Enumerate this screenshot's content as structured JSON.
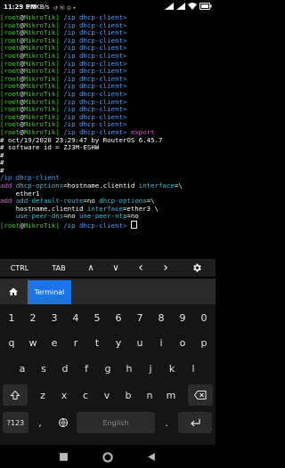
{
  "status_bar": {
    "time": "11:29 PM",
    "data_rate": "0.1KB/s",
    "system_icons": "↺ Ⓝ ⊙ •"
  },
  "terminal": {
    "lines": [
      [
        {
          "t": "[root",
          "c": "g"
        },
        {
          "t": "@",
          "c": "w"
        },
        {
          "t": "MikroTik",
          "c": "g"
        },
        {
          "t": "] ",
          "c": "g"
        },
        {
          "t": "/ip dhcp-client>",
          "c": "b"
        }
      ],
      [
        {
          "t": "[root",
          "c": "g"
        },
        {
          "t": "@",
          "c": "w"
        },
        {
          "t": "MikroTik",
          "c": "g"
        },
        {
          "t": "] ",
          "c": "g"
        },
        {
          "t": "/ip dhcp-client>",
          "c": "b"
        }
      ],
      [
        {
          "t": "[root",
          "c": "g"
        },
        {
          "t": "@",
          "c": "w"
        },
        {
          "t": "MikroTik",
          "c": "g"
        },
        {
          "t": "] ",
          "c": "g"
        },
        {
          "t": "/ip dhcp-client>",
          "c": "b"
        }
      ],
      [
        {
          "t": "[root",
          "c": "g"
        },
        {
          "t": "@",
          "c": "w"
        },
        {
          "t": "MikroTik",
          "c": "g"
        },
        {
          "t": "] ",
          "c": "g"
        },
        {
          "t": "/ip dhcp-client>",
          "c": "b"
        }
      ],
      [
        {
          "t": "[root",
          "c": "g"
        },
        {
          "t": "@",
          "c": "w"
        },
        {
          "t": "MikroTik",
          "c": "g"
        },
        {
          "t": "] ",
          "c": "g"
        },
        {
          "t": "/ip dhcp-client>",
          "c": "b"
        }
      ],
      [
        {
          "t": "[root",
          "c": "g"
        },
        {
          "t": "@",
          "c": "w"
        },
        {
          "t": "MikroTik",
          "c": "g"
        },
        {
          "t": "] ",
          "c": "g"
        },
        {
          "t": "/ip dhcp-client>",
          "c": "b"
        }
      ],
      [
        {
          "t": "[root",
          "c": "g"
        },
        {
          "t": "@",
          "c": "w"
        },
        {
          "t": "MikroTik",
          "c": "g"
        },
        {
          "t": "] ",
          "c": "g"
        },
        {
          "t": "/ip dhcp-client>",
          "c": "b"
        }
      ],
      [
        {
          "t": "[root",
          "c": "g"
        },
        {
          "t": "@",
          "c": "w"
        },
        {
          "t": "MikroTik",
          "c": "g"
        },
        {
          "t": "] ",
          "c": "g"
        },
        {
          "t": "/ip dhcp-client>",
          "c": "b"
        }
      ],
      [
        {
          "t": "[root",
          "c": "g"
        },
        {
          "t": "@",
          "c": "w"
        },
        {
          "t": "MikroTik",
          "c": "g"
        },
        {
          "t": "] ",
          "c": "g"
        },
        {
          "t": "/ip dhcp-client>",
          "c": "b"
        }
      ],
      [
        {
          "t": "[root",
          "c": "g"
        },
        {
          "t": "@",
          "c": "w"
        },
        {
          "t": "MikroTik",
          "c": "g"
        },
        {
          "t": "] ",
          "c": "g"
        },
        {
          "t": "/ip dhcp-client>",
          "c": "b"
        }
      ],
      [
        {
          "t": "[root",
          "c": "g"
        },
        {
          "t": "@",
          "c": "w"
        },
        {
          "t": "MikroTik",
          "c": "g"
        },
        {
          "t": "] ",
          "c": "g"
        },
        {
          "t": "/ip dhcp-client>",
          "c": "b"
        }
      ],
      [
        {
          "t": "[root",
          "c": "g"
        },
        {
          "t": "@",
          "c": "w"
        },
        {
          "t": "MikroTik",
          "c": "g"
        },
        {
          "t": "] ",
          "c": "g"
        },
        {
          "t": "/ip dhcp-client>",
          "c": "b"
        }
      ],
      [
        {
          "t": "[root",
          "c": "g"
        },
        {
          "t": "@",
          "c": "w"
        },
        {
          "t": "MikroTik",
          "c": "g"
        },
        {
          "t": "] ",
          "c": "g"
        },
        {
          "t": "/ip dhcp-client>",
          "c": "b"
        }
      ],
      [
        {
          "t": "[root",
          "c": "g"
        },
        {
          "t": "@",
          "c": "w"
        },
        {
          "t": "MikroTik",
          "c": "g"
        },
        {
          "t": "] ",
          "c": "g"
        },
        {
          "t": "/ip dhcp-client>",
          "c": "b"
        }
      ],
      [
        {
          "t": "[root",
          "c": "g"
        },
        {
          "t": "@",
          "c": "w"
        },
        {
          "t": "MikroTik",
          "c": "g"
        },
        {
          "t": "] ",
          "c": "g"
        },
        {
          "t": "/ip dhcp-client>",
          "c": "b"
        }
      ],
      [
        {
          "t": "[root",
          "c": "g"
        },
        {
          "t": "@",
          "c": "w"
        },
        {
          "t": "MikroTik",
          "c": "g"
        },
        {
          "t": "] ",
          "c": "g"
        },
        {
          "t": "/ip dhcp-client>",
          "c": "b"
        },
        {
          "t": " export",
          "c": "m"
        }
      ],
      [
        {
          "t": "# oct/19/2020 23:29:47 by RouterOS 6.45.7",
          "c": "w"
        }
      ],
      [
        {
          "t": "# software id = ZJ3M-ESHW",
          "c": "w"
        }
      ],
      [
        {
          "t": "#",
          "c": "w"
        }
      ],
      [
        {
          "t": "#",
          "c": "w"
        }
      ],
      [
        {
          "t": "#",
          "c": "w"
        }
      ],
      [
        {
          "t": "/ip dhcp-client",
          "c": "b"
        }
      ],
      [
        {
          "t": "add ",
          "c": "m"
        },
        {
          "t": "dhcp-options",
          "c": "c"
        },
        {
          "t": "=hostname.clientid ",
          "c": "w"
        },
        {
          "t": "interface",
          "c": "c"
        },
        {
          "t": "=\\",
          "c": "w"
        }
      ],
      [
        {
          "t": "    ether1",
          "c": "w"
        }
      ],
      [
        {
          "t": "add ",
          "c": "m"
        },
        {
          "t": "add-default-route",
          "c": "c"
        },
        {
          "t": "=no ",
          "c": "w"
        },
        {
          "t": "dhcp-options",
          "c": "c"
        },
        {
          "t": "=\\",
          "c": "w"
        }
      ],
      [
        {
          "t": "    hostname.clientid ",
          "c": "w"
        },
        {
          "t": "interface",
          "c": "c"
        },
        {
          "t": "=ether3 \\",
          "c": "w"
        }
      ],
      [
        {
          "t": "    ",
          "c": "w"
        },
        {
          "t": "use-peer-dns",
          "c": "c"
        },
        {
          "t": "=no ",
          "c": "w"
        },
        {
          "t": "use-peer-ntp",
          "c": "c"
        },
        {
          "t": "=no",
          "c": "w"
        }
      ],
      [
        {
          "t": "[root",
          "c": "g"
        },
        {
          "t": "@",
          "c": "w"
        },
        {
          "t": "MikroTik",
          "c": "g"
        },
        {
          "t": "] ",
          "c": "g"
        },
        {
          "t": "/ip dhcp-client>",
          "c": "b"
        },
        {
          "t": " ",
          "c": "w"
        }
      ]
    ]
  },
  "extra_keys": {
    "ctrl": "CTRL",
    "tab": "TAB",
    "up": "∧",
    "down": "∨",
    "left": "‹",
    "right": "›",
    "settings_icon": "gear-icon"
  },
  "tab_bar": {
    "home_icon": "home-icon",
    "terminal_tab": "Terminal"
  },
  "keyboard": {
    "number_row": [
      "1",
      "2",
      "3",
      "4",
      "5",
      "6",
      "7",
      "8",
      "9",
      "0"
    ],
    "row1": [
      "q",
      "w",
      "e",
      "r",
      "t",
      "y",
      "u",
      "i",
      "o",
      "p"
    ],
    "row2": [
      "a",
      "s",
      "d",
      "f",
      "g",
      "h",
      "j",
      "k",
      "l"
    ],
    "row3": [
      "z",
      "x",
      "c",
      "v",
      "b",
      "n",
      "m"
    ],
    "symbols_key": "?123",
    "comma_key": ",",
    "space_label": "English",
    "period_key": ".",
    "shift_icon": "shift-icon",
    "backspace_icon": "backspace-icon",
    "globe_icon": "globe-icon",
    "enter_icon": "enter-icon"
  },
  "colors": {
    "prompt_green": "#3bd11f",
    "path_blue": "#4aa3ff",
    "keyword_magenta": "#e15bd7",
    "param_cyan": "#36c0d8",
    "tab_blue": "#1a73e8"
  }
}
